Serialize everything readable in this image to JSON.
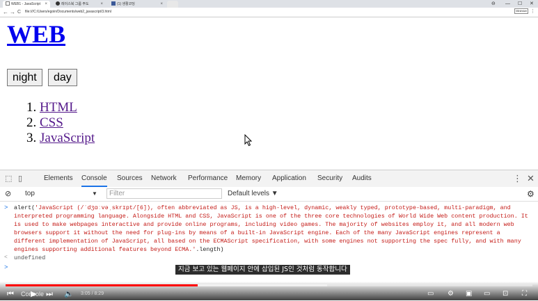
{
  "browser": {
    "tabs": [
      {
        "title": "WEB1 - JavaScript",
        "active": true
      },
      {
        "title": "레이스북 그룹 주도",
        "active": false
      },
      {
        "title": "(1) 생활코딩",
        "active": false
      }
    ],
    "window_controls": {
      "minimize": "—",
      "maximize": "☐",
      "close": "✕",
      "profile": "⊖"
    },
    "nav": {
      "back": "←",
      "forward": "→",
      "reload": "C"
    },
    "url": "file:///C:/Users/egoin/Documents/web2_javascript/3.html",
    "minimize_ext_label": "Minimize",
    "menu": "⋮"
  },
  "page": {
    "heading": "WEB",
    "night_button": "night",
    "day_button": "day",
    "list": [
      {
        "num": "1.",
        "label": "HTML"
      },
      {
        "num": "2.",
        "label": "CSS"
      },
      {
        "num": "3.",
        "label": "JavaScript"
      }
    ]
  },
  "devtools": {
    "tabs": [
      "Elements",
      "Console",
      "Sources",
      "Network",
      "Performance",
      "Memory",
      "Application",
      "Security",
      "Audits"
    ],
    "active_tab": "Console",
    "context": "top",
    "filter_placeholder": "Filter",
    "levels": "Default levels ▼",
    "command_fn": "alert(",
    "command_string": "'JavaScript (/ˈdʒɑːvəˌskrɪpt/[6]), often abbreviated as JS, is a high-level, dynamic, weakly typed, prototype-based, multi-paradigm, and interpreted programming language. Alongside HTML and CSS, JavaScript is one of the three core technologies of World Wide Web content production. It is used to make webpages interactive and provide online programs, including video games. The majority of websites employ it, and all modern web browsers support it without the need for plug-ins by means of a built-in JavaScript engine. Each of the many JavaScript engines represent a different implementation of JavaScript, all based on the ECMAScript specification, with some engines not supporting the spec fully, and with many engines supporting additional features beyond ECMA.'",
    "command_tail": ".length)",
    "result": "undefined",
    "prompt_symbol": ">",
    "result_symbol": "<"
  },
  "video": {
    "caption": "지금 보고 있는 웹페이지 안에 삽입된 JS인 것처럼 동작합니다",
    "time": "3:05 / 8:29",
    "played_fraction": 0.364,
    "loaded_fraction": 0.61,
    "overlay_label": "Console",
    "accent": "#ff0000"
  }
}
